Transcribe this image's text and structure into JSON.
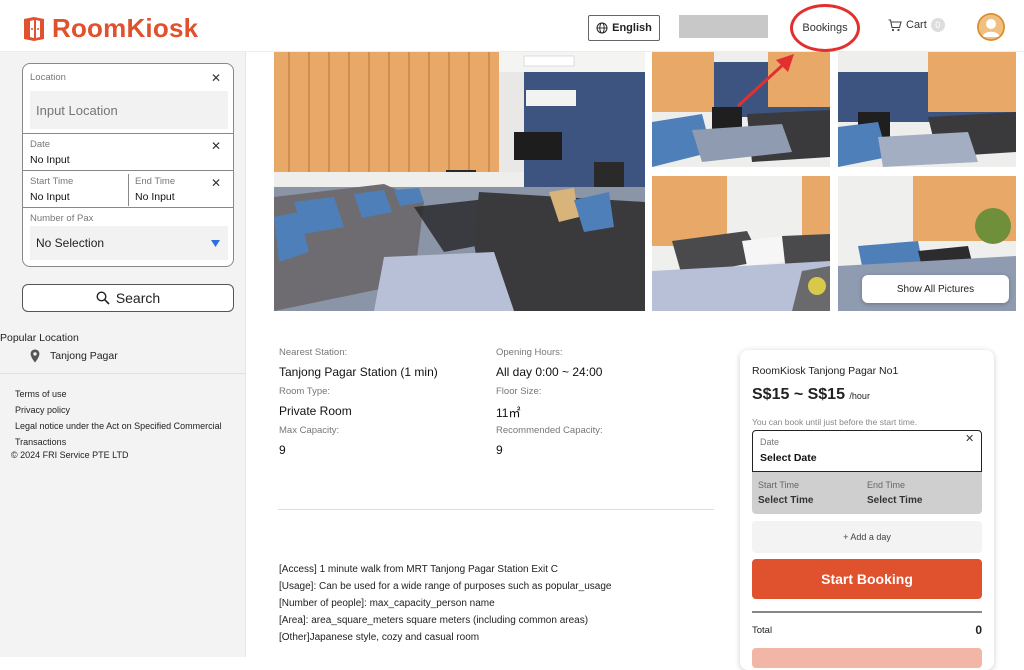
{
  "header": {
    "brand": "RoomKiosk",
    "language": "English",
    "bookings": "Bookings",
    "cart_label": "Cart",
    "cart_count": "0",
    "brand_color": "#e0512e",
    "highlight_color": "#e23030"
  },
  "search": {
    "location_label": "Location",
    "location_placeholder": "Input Location",
    "date_label": "Date",
    "date_value": "No Input",
    "start_label": "Start Time",
    "start_value": "No Input",
    "end_label": "End Time",
    "end_value": "No Input",
    "pax_label": "Number of Pax",
    "pax_value": "No Selection",
    "search_button": "Search"
  },
  "popular": {
    "title": "Popular Location",
    "items": [
      {
        "label": "Tanjong Pagar"
      }
    ]
  },
  "footer": {
    "terms": "Terms of use",
    "privacy": "Privacy policy",
    "legal_line1": "Legal notice under the Act on Specified Commercial",
    "legal_line2": "Transactions",
    "copyright": "© 2024 FRI Service PTE LTD"
  },
  "gallery": {
    "show_all": "Show All Pictures"
  },
  "details": {
    "station_label": "Nearest Station:",
    "station_value": "Tanjong Pagar Station (1 min)",
    "hours_label": "Opening Hours:",
    "hours_value": "All day 0:00 ~ 24:00",
    "room_type_label": "Room Type:",
    "room_type_value": "Private Room",
    "floor_label": "Floor Size:",
    "floor_value": "11㎡",
    "max_label": "Max Capacity:",
    "max_value": "9",
    "rec_label": "Recommended Capacity:",
    "rec_value": "9"
  },
  "description": [
    "[Access] 1 minute walk from MRT Tanjong Pagar Station Exit C",
    "[Usage]: Can be used for a wide range of purposes such as popular_usage",
    "[Number of people]: max_capacity_person name",
    "[Area]: area_square_meters square meters (including common areas)",
    "[Other]Japanese style, cozy and casual room"
  ],
  "booking": {
    "room_name": "RoomKiosk Tanjong Pagar No1",
    "price": "S$15 ~ S$15",
    "unit": "/hour",
    "note": "You can book until just before the start time.",
    "date_label": "Date",
    "date_value": "Select Date",
    "start_label": "Start Time",
    "start_value": "Select Time",
    "end_label": "End Time",
    "end_value": "Select Time",
    "add_day": "+ Add a day",
    "start_booking": "Start Booking",
    "total_label": "Total",
    "total_value": "0"
  }
}
